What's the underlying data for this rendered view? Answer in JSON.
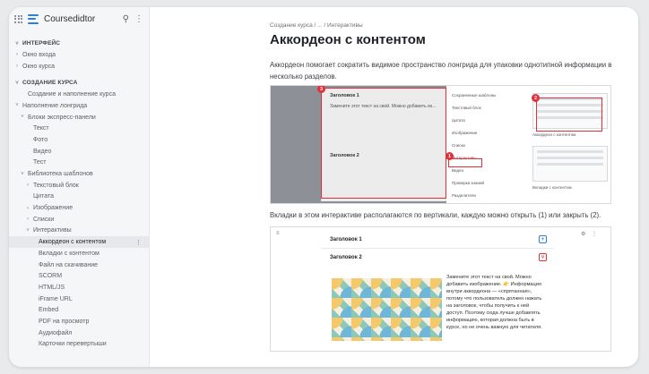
{
  "app": {
    "name": "Coursedidtor"
  },
  "sidebar": {
    "sections": [
      {
        "title": "ИНТЕРФЕЙС",
        "items": [
          "Окно входа",
          "Окно курса"
        ]
      },
      {
        "title": "СОЗДАНИЕ КУРСА"
      }
    ],
    "items": [
      {
        "label": "Создание и наполнение курса",
        "level": 1,
        "chev": ""
      },
      {
        "label": "Наполнение лонгрида",
        "level": 0,
        "chev": "v"
      },
      {
        "label": "Блоки экспресс-панели",
        "level": 1,
        "chev": "v"
      },
      {
        "label": "Текст",
        "level": 2,
        "chev": ""
      },
      {
        "label": "Фото",
        "level": 2,
        "chev": ""
      },
      {
        "label": "Видео",
        "level": 2,
        "chev": ""
      },
      {
        "label": "Тест",
        "level": 2,
        "chev": ""
      },
      {
        "label": "Библиотека шаблонов",
        "level": 1,
        "chev": "v"
      },
      {
        "label": "Текстовый блок",
        "level": 2,
        "chev": ">"
      },
      {
        "label": "Цитата",
        "level": 2,
        "chev": ""
      },
      {
        "label": "Изображение",
        "level": 2,
        "chev": ">"
      },
      {
        "label": "Списки",
        "level": 2,
        "chev": ">"
      },
      {
        "label": "Интерактивы",
        "level": 2,
        "chev": "v"
      },
      {
        "label": "Аккордеон с контентом",
        "level": 3,
        "chev": "",
        "active": true
      },
      {
        "label": "Вкладки с контентом",
        "level": 3,
        "chev": ""
      },
      {
        "label": "Файл на скачивание",
        "level": 3,
        "chev": ""
      },
      {
        "label": "SCORM",
        "level": 3,
        "chev": ""
      },
      {
        "label": "HTML/JS",
        "level": 3,
        "chev": ""
      },
      {
        "label": "iFrame URL",
        "level": 3,
        "chev": ""
      },
      {
        "label": "Embed",
        "level": 3,
        "chev": ""
      },
      {
        "label": "PDF на просмотр",
        "level": 3,
        "chev": ""
      },
      {
        "label": "Аудиофайл",
        "level": 3,
        "chev": ""
      },
      {
        "label": "Карточки перевертыши",
        "level": 3,
        "chev": ""
      }
    ]
  },
  "main": {
    "breadcrumb": "Создание курса / ... / Интерактивы",
    "title": "Аккордеон с контентом",
    "intro": "Аккордеон помогает сократить видимое пространство лонгрида для упаковки однотипной информации в несколько разделов.",
    "tabs_text": "Вкладки в этом интерактиве располагаются по вертикали, каждую можно открыть (1) или закрыть (2).",
    "shot1": {
      "heading1": "Заголовок 1",
      "body": "Замените этот текст на свой. Можно добавить из...",
      "heading2": "Заголовок 2",
      "palette": [
        "Сохраненные шаблоны",
        "Текстовый блок",
        "Цитата",
        "Изображение",
        "Списки",
        "Интерактивы",
        "Видео",
        "Проверка знаний",
        "Разделители"
      ],
      "caption1": "Аккордеон с контентом",
      "caption2": "Вкладки с контентом",
      "badges": [
        "1",
        "2",
        "3"
      ]
    },
    "shot2": {
      "heading1": "Заголовок 1",
      "heading2": "Заголовок 2",
      "body": "Замените этот текст на свой. Можно добавить изображение. 👉 Информация внутри аккордеона — «спрятанная», потому что пользователь должен нажать на заголовок, чтобы получить к ней доступ. Поэтому сюда лучше добавлять информацию, которая должна быть в курсе, но не очень важную для читателя."
    }
  },
  "colors": {
    "accent": "#2f7fd8",
    "highlight": "#e0303a"
  }
}
